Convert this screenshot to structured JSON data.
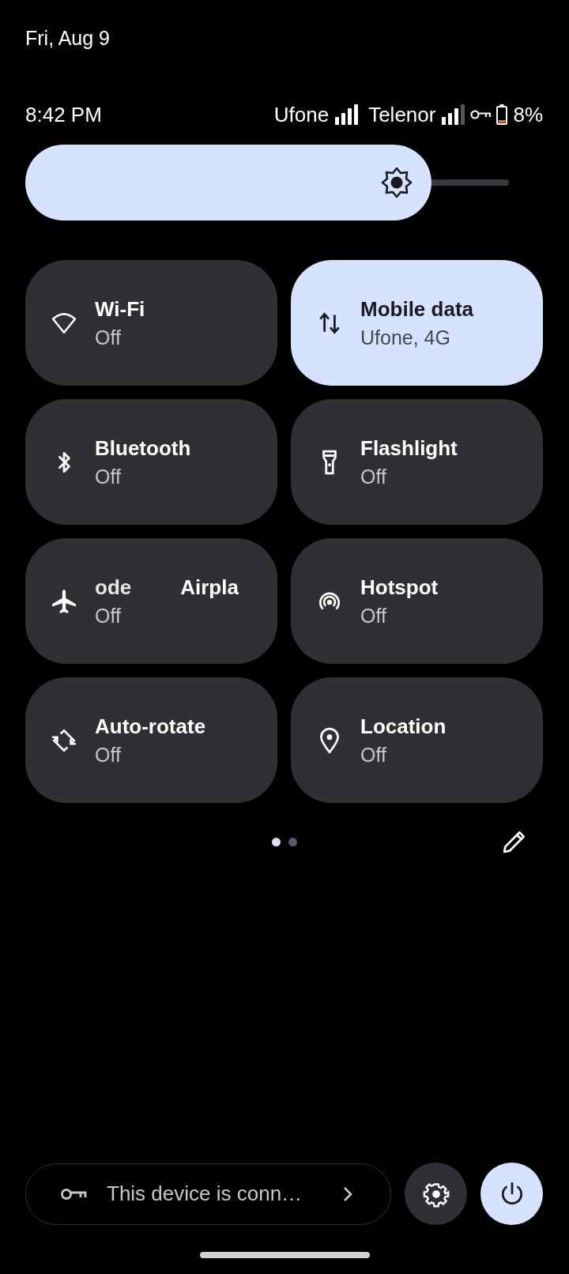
{
  "header": {
    "date": "Fri, Aug 9"
  },
  "status_bar": {
    "time": "8:42 PM",
    "carriers": [
      "Ufone",
      "Telenor"
    ],
    "battery": "8%"
  },
  "brightness": {
    "level": 0.84
  },
  "tiles": [
    {
      "title": "Wi-Fi",
      "subtitle": "Off",
      "selected": false
    },
    {
      "title": "Mobile data",
      "subtitle": "Ufone, 4G",
      "selected": true
    },
    {
      "title": "Bluetooth",
      "subtitle": "Off",
      "selected": false
    },
    {
      "title": "Flashlight",
      "subtitle": "Off",
      "selected": false
    },
    {
      "title_parts": [
        "ode",
        "Airpla"
      ],
      "subtitle": "Off",
      "selected": false
    },
    {
      "title": "Hotspot",
      "subtitle": "Off",
      "selected": false
    },
    {
      "title": "Auto-rotate",
      "subtitle": "Off",
      "selected": false
    },
    {
      "title": "Location",
      "subtitle": "Off",
      "selected": false
    }
  ],
  "pages": [
    {
      "selected": true
    },
    {
      "selected": false
    }
  ],
  "footer": {
    "security_text": "This device is conn…"
  }
}
